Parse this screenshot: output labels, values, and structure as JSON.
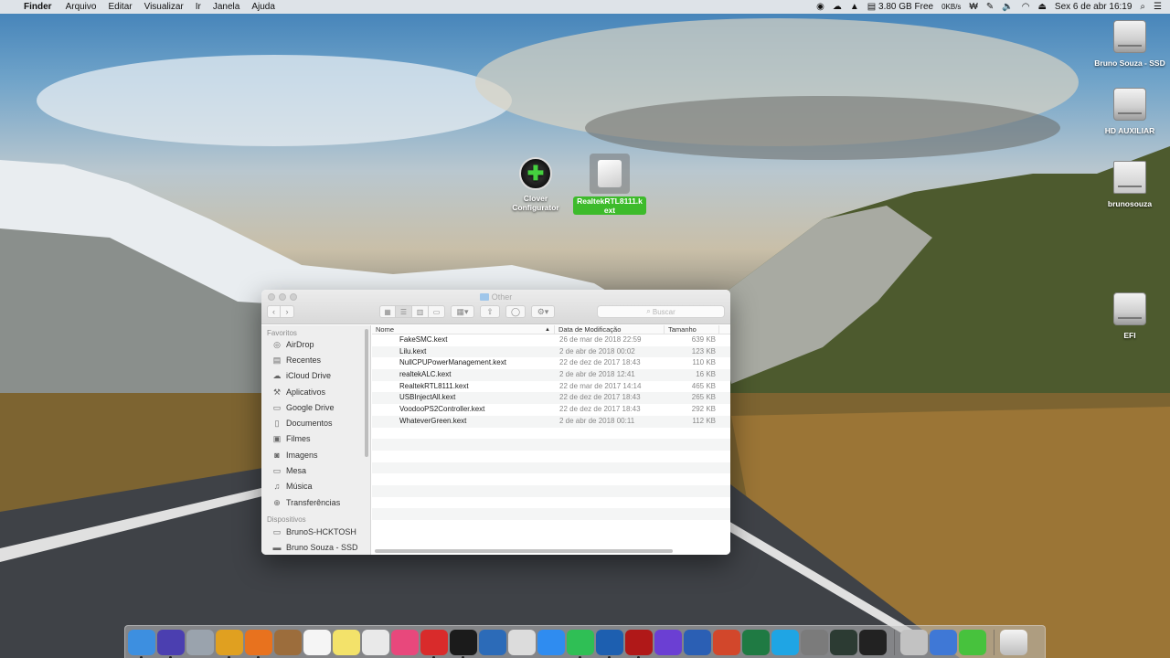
{
  "menubar": {
    "app_name": "Finder",
    "menus": [
      "Arquivo",
      "Editar",
      "Visualizar",
      "Ir",
      "Janela",
      "Ajuda"
    ],
    "disk_free": "3.80 GB Free",
    "net_up": "0",
    "net_rate": "KB/s",
    "datetime": "Sex 6 de abr  16:19"
  },
  "desktop": {
    "right_icons": [
      {
        "label": "Bruno Souza - SSD",
        "icon": "hard-drive-icon"
      },
      {
        "label": "HD AUXILIAR",
        "icon": "hard-drive-icon"
      },
      {
        "label": "brunosouza",
        "icon": "home-folder-icon"
      },
      {
        "label": "EFI",
        "icon": "hard-drive-icon"
      }
    ],
    "clover_label": "Clover Configurator",
    "dragged_label": "RealtekRTL8111.kext"
  },
  "finder": {
    "title": "Other",
    "search_placeholder": "Buscar",
    "sidebar": {
      "favorites_header": "Favoritos",
      "favorites": [
        {
          "label": "AirDrop",
          "icon": "airdrop-icon"
        },
        {
          "label": "Recentes",
          "icon": "recents-icon"
        },
        {
          "label": "iCloud Drive",
          "icon": "cloud-icon"
        },
        {
          "label": "Aplicativos",
          "icon": "applications-icon"
        },
        {
          "label": "Google Drive",
          "icon": "folder-icon"
        },
        {
          "label": "Documentos",
          "icon": "document-icon"
        },
        {
          "label": "Filmes",
          "icon": "movies-icon"
        },
        {
          "label": "Imagens",
          "icon": "camera-icon"
        },
        {
          "label": "Mesa",
          "icon": "desktop-icon"
        },
        {
          "label": "Música",
          "icon": "music-icon"
        },
        {
          "label": "Transferências",
          "icon": "download-icon"
        }
      ],
      "devices_header": "Dispositivos",
      "devices": [
        {
          "label": "BrunoS-HCKTOSH",
          "icon": "computer-icon"
        },
        {
          "label": "Bruno Souza - SSD",
          "icon": "hard-drive-icon"
        }
      ]
    },
    "columns": {
      "name": "Nome",
      "date": "Data de Modificação",
      "size": "Tamanho"
    },
    "files": [
      {
        "name": "FakeSMC.kext",
        "date": "26 de mar de 2018 22:59",
        "size": "639 KB"
      },
      {
        "name": "Lilu.kext",
        "date": "2 de abr de 2018 00:02",
        "size": "123 KB"
      },
      {
        "name": "NullCPUPowerManagement.kext",
        "date": "22 de dez de 2017 18:43",
        "size": "110 KB"
      },
      {
        "name": "realtekALC.kext",
        "date": "2 de abr de 2018 12:41",
        "size": "16 KB"
      },
      {
        "name": "RealtekRTL8111.kext",
        "date": "22 de mar de 2017 14:14",
        "size": "465 KB"
      },
      {
        "name": "USBInjectAll.kext",
        "date": "22 de dez de 2017 18:43",
        "size": "265 KB"
      },
      {
        "name": "VoodooPS2Controller.kext",
        "date": "22 de dez de 2017 18:43",
        "size": "292 KB"
      },
      {
        "name": "WhateverGreen.kext",
        "date": "2 de abr de 2018 00:11",
        "size": "112 KB"
      }
    ]
  },
  "dock": {
    "apps": [
      {
        "name": "finder-icon",
        "color": "#3d8fe0"
      },
      {
        "name": "siri-icon",
        "color": "#4b3fb0"
      },
      {
        "name": "launchpad-icon",
        "color": "#9aa3ad"
      },
      {
        "name": "chrome-icon",
        "color": "#e0a020"
      },
      {
        "name": "firefox-icon",
        "color": "#e8721e"
      },
      {
        "name": "notes-book-icon",
        "color": "#9c6d3c"
      },
      {
        "name": "calendar-icon",
        "color": "#f5f5f5"
      },
      {
        "name": "stickies-icon",
        "color": "#f3e26a"
      },
      {
        "name": "photos-icon",
        "color": "#e9e9e9"
      },
      {
        "name": "itunes-icon",
        "color": "#e8487c"
      },
      {
        "name": "scrobbler-icon",
        "color": "#d92b2b"
      },
      {
        "name": "activity-icon",
        "color": "#1b1b1b"
      },
      {
        "name": "audio-app-icon",
        "color": "#2c6bb8"
      },
      {
        "name": "virtualbox-icon",
        "color": "#dcdcdc"
      },
      {
        "name": "app-store-icon",
        "color": "#2f8cf0"
      },
      {
        "name": "whatsapp-icon",
        "color": "#2fbf55"
      },
      {
        "name": "teamviewer-icon",
        "color": "#1d5fb0"
      },
      {
        "name": "game-icon",
        "color": "#b01818"
      },
      {
        "name": "imovie-star-icon",
        "color": "#6b3fd3"
      },
      {
        "name": "word-icon",
        "color": "#2b5fb4"
      },
      {
        "name": "powerpoint-icon",
        "color": "#d2472b"
      },
      {
        "name": "excel-icon",
        "color": "#1f7a43"
      },
      {
        "name": "skype-icon",
        "color": "#1fa5e4"
      },
      {
        "name": "system-preferences-icon",
        "color": "#7b7b7b"
      },
      {
        "name": "activity-monitor-icon",
        "color": "#2c3b33"
      },
      {
        "name": "terminal-icon",
        "color": "#222"
      },
      {
        "name": "disk-utility-icon",
        "color": "#c2c2c2"
      },
      {
        "name": "downloads-app-icon",
        "color": "#3f78d6"
      },
      {
        "name": "clover-icon",
        "color": "#47c23d"
      }
    ],
    "running": [
      0,
      1,
      3,
      4,
      10,
      11,
      15,
      16,
      17
    ]
  }
}
